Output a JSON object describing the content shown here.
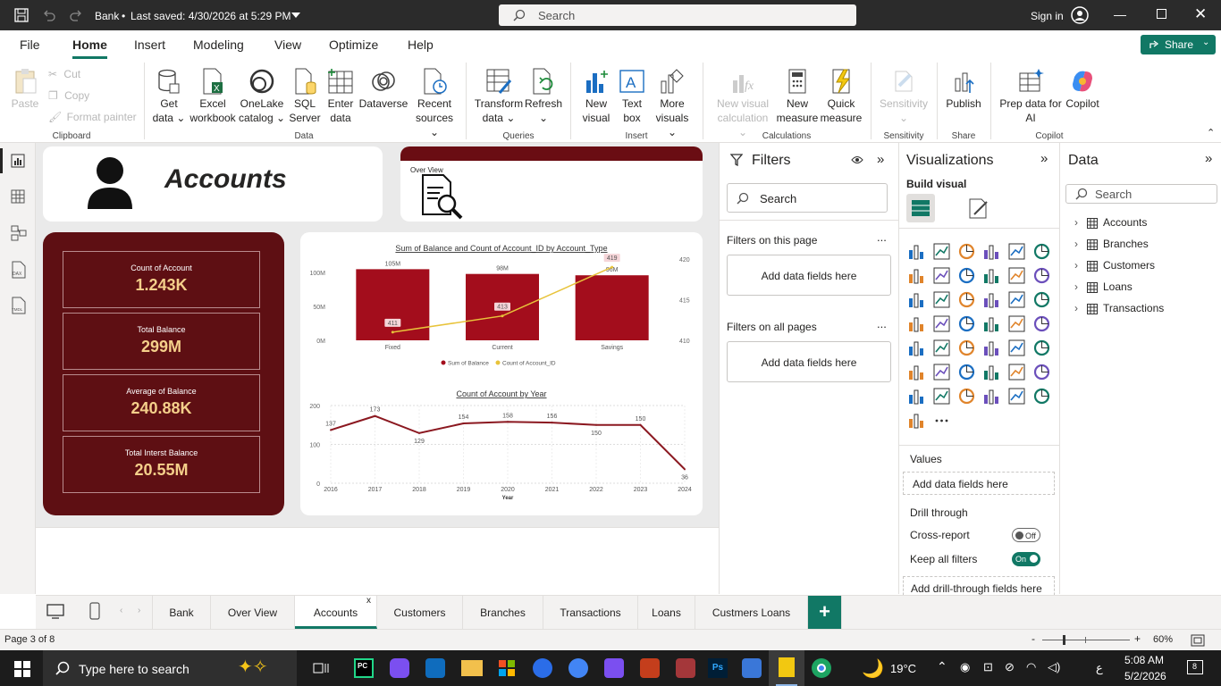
{
  "titlebar": {
    "filename": "Bank",
    "saved": "Last saved: 4/30/2026 at 5:29 PM",
    "search_placeholder": "Search",
    "signin": "Sign in"
  },
  "menu": {
    "file": "File",
    "home": "Home",
    "insert": "Insert",
    "modeling": "Modeling",
    "view": "View",
    "optimize": "Optimize",
    "help": "Help",
    "share": "Share"
  },
  "ribbon": {
    "clipboard": {
      "paste": "Paste",
      "cut": "Cut",
      "copy": "Copy",
      "format_painter": "Format painter",
      "label": "Clipboard"
    },
    "data": {
      "get_data": "Get",
      "get_data2": "data",
      "excel": "Excel",
      "excel2": "workbook",
      "onelake": "OneLake",
      "onelake2": "catalog",
      "sql": "SQL",
      "sql2": "Server",
      "enter": "Enter",
      "enter2": "data",
      "dataverse": "Dataverse",
      "recent": "Recent",
      "recent2": "sources",
      "label": "Data"
    },
    "queries": {
      "transform": "Transform",
      "transform2": "data",
      "refresh": "Refresh",
      "label": "Queries"
    },
    "insert": {
      "new_visual": "New",
      "new_visual2": "visual",
      "text_box": "Text",
      "text_box2": "box",
      "more_visuals": "More",
      "more_visuals2": "visuals",
      "label": "Insert"
    },
    "calculations": {
      "new_calc": "New visual",
      "new_calc2": "calculation",
      "new_measure": "New",
      "new_measure2": "measure",
      "quick_measure": "Quick",
      "quick_measure2": "measure",
      "label": "Calculations"
    },
    "sensitivity": {
      "btn": "Sensitivity",
      "label": "Sensitivity"
    },
    "share": {
      "publish": "Publish",
      "label": "Share"
    },
    "copilot": {
      "prep": "Prep data for",
      "prep2": "AI",
      "copilot": "Copilot",
      "label": "Copilot"
    }
  },
  "report": {
    "header_title": "Accounts",
    "overview_label": "Over View",
    "kpis": [
      {
        "label": "Count of Account",
        "value": "1.243K"
      },
      {
        "label": "Total Balance",
        "value": "299M"
      },
      {
        "label": "Average of Balance",
        "value": "240.88K"
      },
      {
        "label": "Total Interst Balance",
        "value": "20.55M"
      }
    ]
  },
  "chart_data": [
    {
      "type": "bar",
      "title": "Sum of Balance and Count of Account_ID by Account_Type",
      "categories": [
        "Fixed",
        "Current",
        "Savings"
      ],
      "series": [
        {
          "name": "Sum of Balance",
          "values": [
            105,
            98,
            96
          ],
          "data_labels": [
            "105M",
            "98M",
            "96M"
          ],
          "color": "#a30d1c"
        },
        {
          "name": "Count of Account_ID",
          "values": [
            411,
            413,
            419
          ],
          "data_labels": [
            "411",
            "413",
            "419"
          ],
          "color": "#e8c33a"
        }
      ],
      "y_left_ticks": [
        "0M",
        "50M",
        "100M"
      ],
      "y_left_range": [
        0,
        120
      ],
      "y_right_ticks": [
        "410",
        "415",
        "420"
      ],
      "y_right_range": [
        410,
        420
      ],
      "legend": "bottom-center"
    },
    {
      "type": "line",
      "title": "Count of Account by Year",
      "xlabel": "Year",
      "x": [
        "2016",
        "2017",
        "2018",
        "2019",
        "2020",
        "2021",
        "2022",
        "2023",
        "2024"
      ],
      "series": [
        {
          "values": [
            137,
            173,
            129,
            154,
            158,
            156,
            150,
            150,
            36
          ],
          "color": "#8b1820"
        }
      ],
      "y_ticks": [
        "0",
        "100",
        "200"
      ],
      "ylim": [
        0,
        200
      ],
      "grid": true
    }
  ],
  "filters": {
    "title": "Filters",
    "search": "Search",
    "on_page": "Filters on this page",
    "on_page_drop": "Add data fields here",
    "all_pages": "Filters on all pages",
    "all_pages_drop": "Add data fields here",
    "more": "..."
  },
  "visualizations": {
    "title": "Visualizations",
    "build": "Build visual",
    "values": "Values",
    "values_drop": "Add data fields here",
    "drill": "Drill through",
    "cross_report": "Cross-report",
    "cross_off": "Off",
    "keep_filters": "Keep all filters",
    "keep_on": "On",
    "drill_drop": "Add drill-through fields here",
    "more": "..."
  },
  "data_pane": {
    "title": "Data",
    "search": "Search",
    "tables": [
      "Accounts",
      "Branches",
      "Customers",
      "Loans",
      "Transactions"
    ]
  },
  "pages": {
    "tabs": [
      "Bank",
      "Over View",
      "Accounts",
      "Customers",
      "Branches",
      "Transactions",
      "Loans",
      "Custmers Loans"
    ],
    "close": "x",
    "add": "+"
  },
  "status": {
    "page": "Page 3 of 8",
    "zoom": "60%",
    "minus": "-",
    "plus": "+"
  },
  "taskbar": {
    "search": "Type here to search",
    "temp": "19°C",
    "time": "5:08 AM",
    "date": "5/2/2026",
    "lang": "ع",
    "notif": "8"
  },
  "colors": {
    "accent": "#117865",
    "kpi_bg": "#5e0f13",
    "bar": "#a30d1c",
    "line": "#e8c33a",
    "kpi_value": "#f4cf8a"
  }
}
